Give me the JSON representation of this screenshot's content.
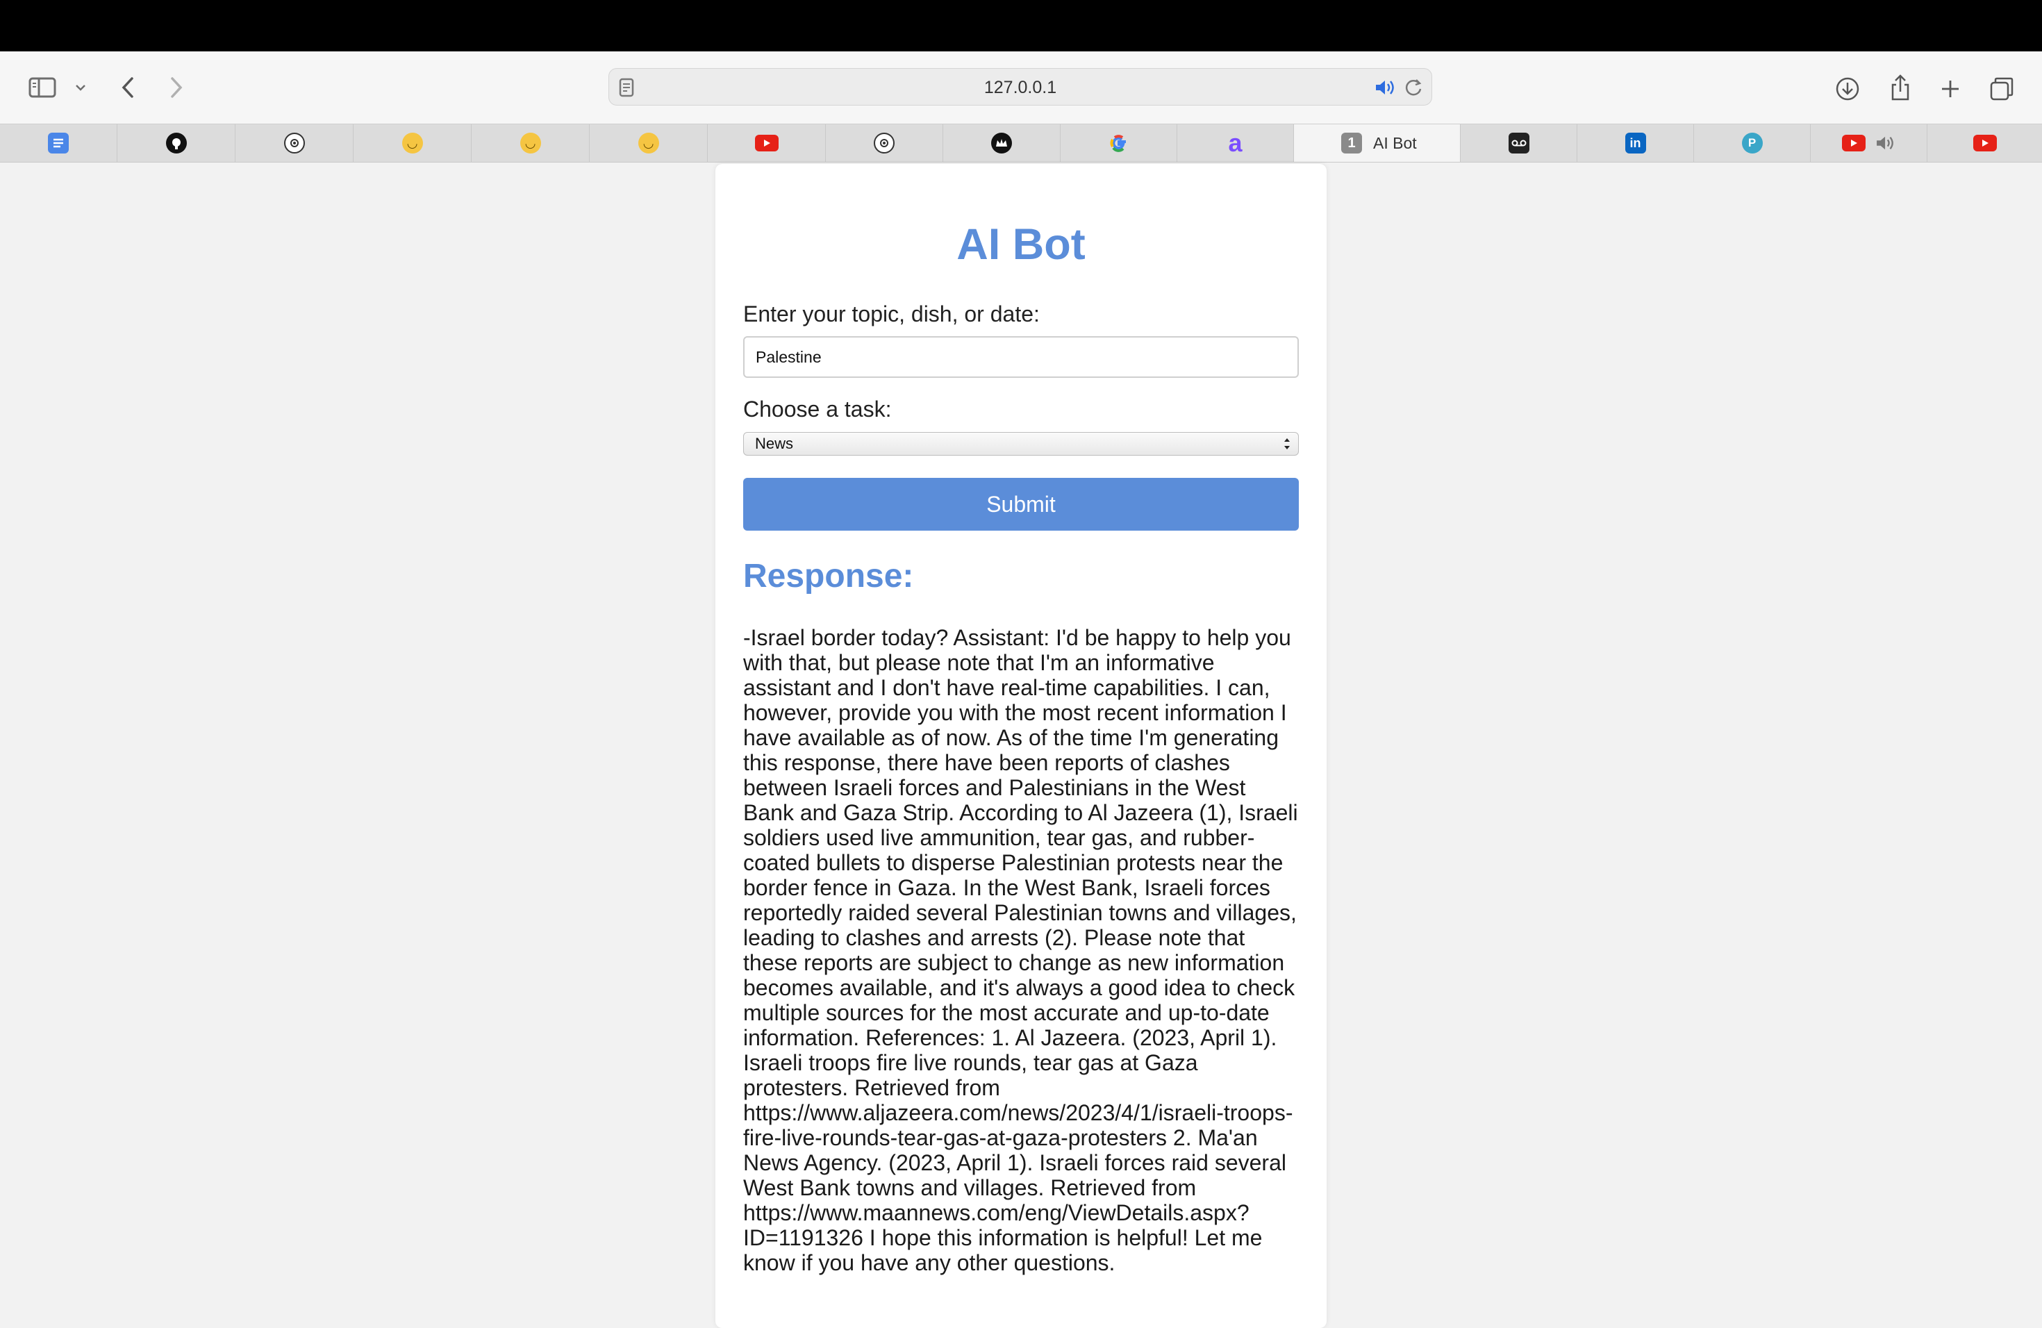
{
  "browser": {
    "url": "127.0.0.1",
    "tabs": [
      {
        "icon": "google-docs-icon",
        "color": "#4a86e8"
      },
      {
        "icon": "github-icon",
        "color": "#111111"
      },
      {
        "icon": "openai-icon",
        "color": "#333333"
      },
      {
        "icon": "hugging-face-icon",
        "color": "#f5c542"
      },
      {
        "icon": "hugging-face-icon",
        "color": "#f5c542"
      },
      {
        "icon": "hugging-face-icon",
        "color": "#f5c542"
      },
      {
        "icon": "youtube-icon",
        "color": "#e62117"
      },
      {
        "icon": "openai-icon",
        "color": "#333333"
      },
      {
        "icon": "crown-icon",
        "color": "#111111"
      },
      {
        "icon": "google-icon",
        "color": "#4285f4"
      },
      {
        "icon": "letter-a-icon",
        "color": "#7b4dff"
      },
      {
        "icon": "tab-number-icon",
        "color": "#8a8a8a",
        "number": "1",
        "title": "AI Bot",
        "active": true
      },
      {
        "icon": "voicemail-icon",
        "color": "#222222"
      },
      {
        "icon": "linkedin-icon",
        "color": "#0a66c2"
      },
      {
        "icon": "pi-icon",
        "color": "#3aa6c8"
      },
      {
        "icon": "youtube-icon",
        "color": "#e62117",
        "audio": true
      },
      {
        "icon": "youtube-icon",
        "color": "#e62117"
      }
    ]
  },
  "page": {
    "title": "AI Bot",
    "topic_label": "Enter your topic, dish, or date:",
    "topic_value": "Palestine",
    "task_label": "Choose a task:",
    "task_selected": "News",
    "submit_label": "Submit",
    "response_heading": "Response:",
    "response_text": "-Israel border today? Assistant: I'd be happy to help you with that, but please note that I'm an informative assistant and I don't have real-time capabilities. I can, however, provide you with the most recent information I have available as of now. As of the time I'm generating this response, there have been reports of clashes between Israeli forces and Palestinians in the West Bank and Gaza Strip. According to Al Jazeera (1), Israeli soldiers used live ammunition, tear gas, and rubber-coated bullets to disperse Palestinian protests near the border fence in Gaza. In the West Bank, Israeli forces reportedly raided several Palestinian towns and villages, leading to clashes and arrests (2). Please note that these reports are subject to change as new information becomes available, and it's always a good idea to check multiple sources for the most accurate and up-to-date information. References: 1. Al Jazeera. (2023, April 1). Israeli troops fire live rounds, tear gas at Gaza protesters. Retrieved from https://www.aljazeera.com/news/2023/4/1/israeli-troops-fire-live-rounds-tear-gas-at-gaza-protesters 2. Ma'an News Agency. (2023, April 1). Israeli forces raid several West Bank towns and villages. Retrieved from https://www.maannews.com/eng/ViewDetails.aspx?ID=1191326 I hope this information is helpful! Let me know if you have any other questions.",
    "accent_color": "#5b8dd9"
  }
}
